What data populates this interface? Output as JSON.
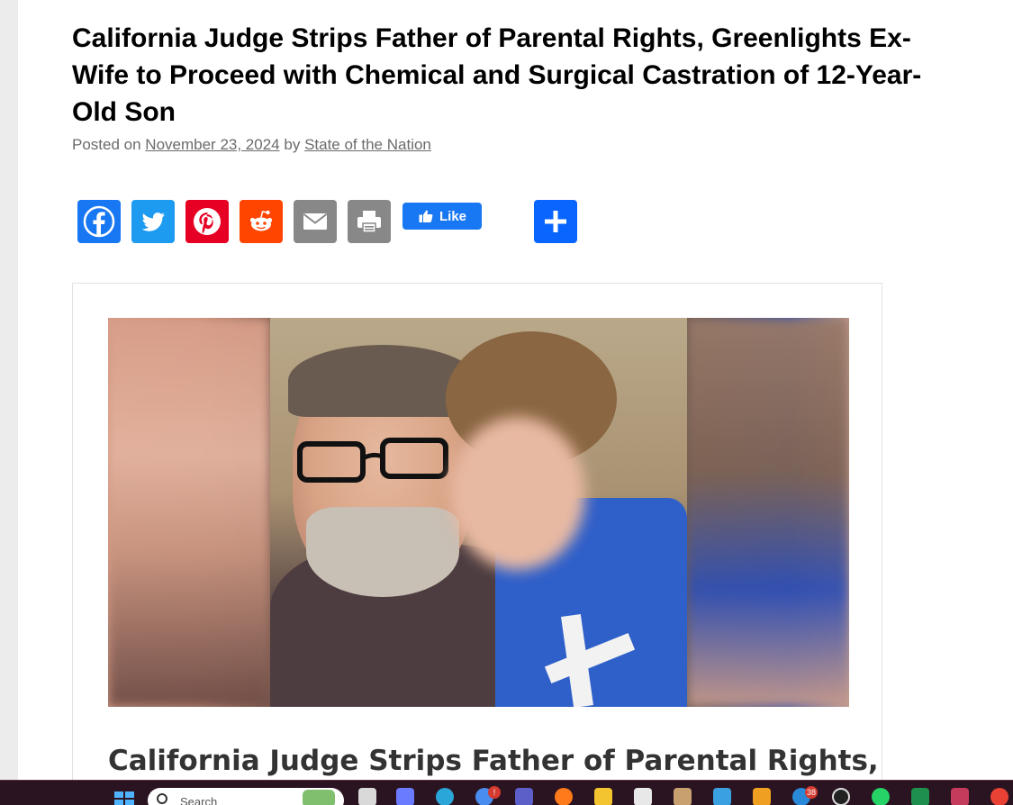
{
  "article": {
    "title": "California Judge Strips Father of Parental Rights, Greenlights Ex-Wife to Proceed with Chemical and Surgical Castration of 12-Year-Old Son",
    "byline": {
      "posted_on": "Posted on",
      "date": "November 23, 2024",
      "by": "by",
      "author": "State of the Nation"
    },
    "card_heading": "California Judge Strips Father of Parental Rights,"
  },
  "share": {
    "buttons": [
      {
        "icon": "facebook-icon",
        "color": "#1877f2"
      },
      {
        "icon": "twitter-icon",
        "color": "#1d9bf0"
      },
      {
        "icon": "pinterest-icon",
        "color": "#e60023"
      },
      {
        "icon": "reddit-icon",
        "color": "#ff4500"
      },
      {
        "icon": "email-icon",
        "color": "#888888"
      },
      {
        "icon": "print-icon",
        "color": "#888888"
      }
    ],
    "like_label": "Like",
    "more_icon": "plus-icon",
    "more_color": "#0866ff"
  },
  "taskbar": {
    "search_placeholder": "Search",
    "badges": {
      "notification": "!",
      "count": "38"
    }
  }
}
